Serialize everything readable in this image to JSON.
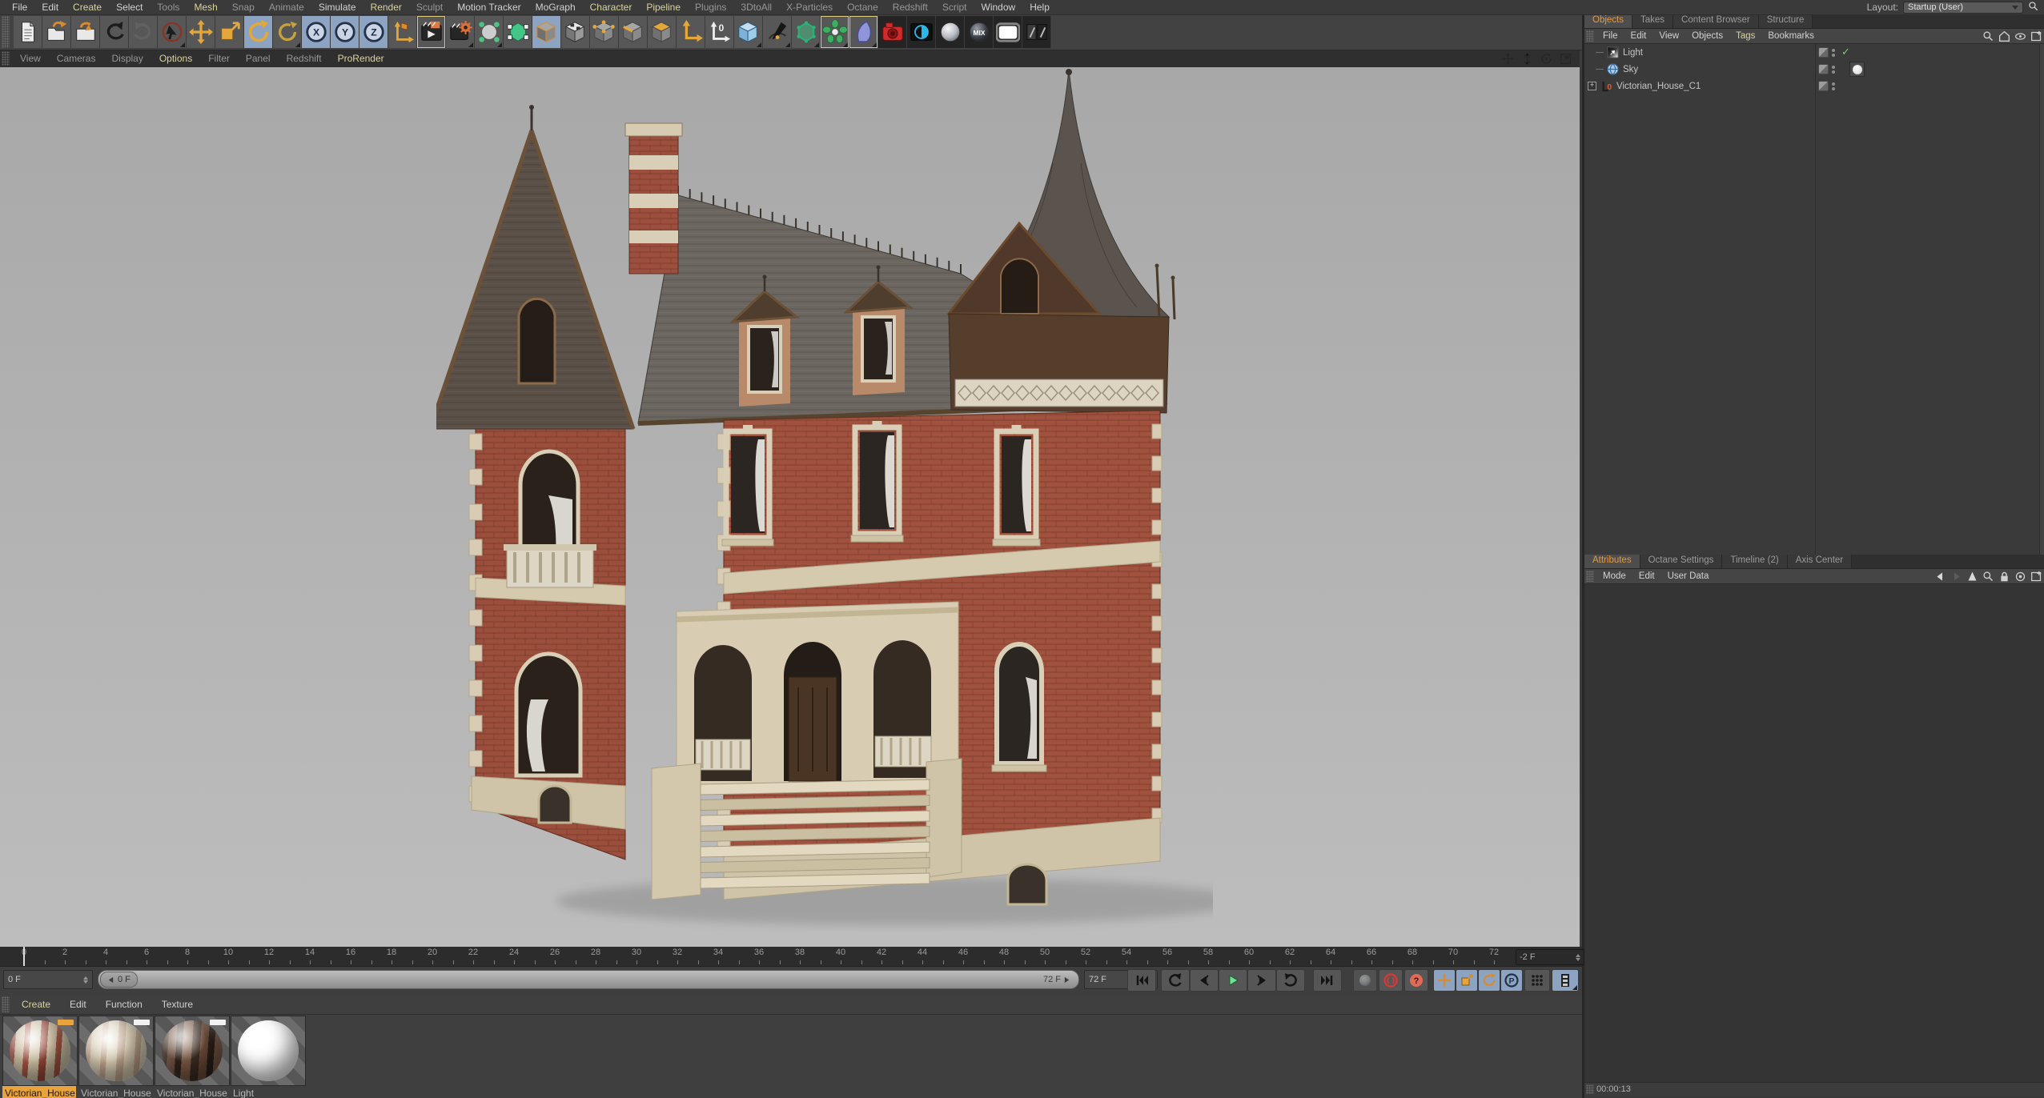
{
  "colors": {
    "accent_orange": "#e09a47",
    "accent_yellow": "#d9d49c",
    "blue_highlight": "#8ca4c2",
    "selected_material": "#e8a33d",
    "play_green": "#6fe08d",
    "record_red": "#d23a3a"
  },
  "menu_bar": {
    "items": [
      {
        "label": "File",
        "tone": "normal"
      },
      {
        "label": "Edit",
        "tone": "normal"
      },
      {
        "label": "Create",
        "tone": "accent"
      },
      {
        "label": "Select",
        "tone": "normal"
      },
      {
        "label": "Tools",
        "tone": "dim"
      },
      {
        "label": "Mesh",
        "tone": "accent"
      },
      {
        "label": "Snap",
        "tone": "dim"
      },
      {
        "label": "Animate",
        "tone": "dim"
      },
      {
        "label": "Simulate",
        "tone": "normal"
      },
      {
        "label": "Render",
        "tone": "accent"
      },
      {
        "label": "Sculpt",
        "tone": "dim"
      },
      {
        "label": "Motion Tracker",
        "tone": "normal"
      },
      {
        "label": "MoGraph",
        "tone": "normal"
      },
      {
        "label": "Character",
        "tone": "accent"
      },
      {
        "label": "Pipeline",
        "tone": "accent"
      },
      {
        "label": "Plugins",
        "tone": "dim"
      },
      {
        "label": "3DtoAll",
        "tone": "dim"
      },
      {
        "label": "X-Particles",
        "tone": "dim"
      },
      {
        "label": "Octane",
        "tone": "dim"
      },
      {
        "label": "Redshift",
        "tone": "dim"
      },
      {
        "label": "Script",
        "tone": "dim"
      },
      {
        "label": "Window",
        "tone": "normal"
      },
      {
        "label": "Help",
        "tone": "normal"
      }
    ],
    "layout_label": "Layout:",
    "layout_value": "Startup (User)"
  },
  "toolbar": {
    "icons": [
      {
        "name": "new-file-icon"
      },
      {
        "name": "open-file-icon"
      },
      {
        "name": "save-file-icon"
      },
      {
        "name": "undo-icon"
      },
      {
        "name": "redo-icon",
        "disabled": true
      },
      {
        "name": "select-tool-icon",
        "corner": true
      },
      {
        "name": "move-tool-icon"
      },
      {
        "name": "scale-tool-icon"
      },
      {
        "name": "rotate-tool-icon",
        "bg": "blue"
      },
      {
        "name": "last-tool-icon",
        "corner": true
      },
      {
        "name": "lock-x-icon",
        "bg": "blue",
        "letter": "X"
      },
      {
        "name": "lock-y-icon",
        "bg": "blue",
        "letter": "Y"
      },
      {
        "name": "lock-z-icon",
        "bg": "blue",
        "letter": "Z"
      },
      {
        "name": "coord-system-icon"
      },
      {
        "name": "render-view-icon",
        "frame": "yellow"
      },
      {
        "name": "render-settings-icon",
        "corner": true
      },
      {
        "name": "subdivision-surface-icon",
        "corner": true
      },
      {
        "name": "make-editable-icon"
      },
      {
        "name": "model-mode-icon",
        "bg": "blue"
      },
      {
        "name": "texture-mode-icon"
      },
      {
        "name": "point-mode-icon"
      },
      {
        "name": "edge-mode-icon"
      },
      {
        "name": "polygon-mode-icon"
      },
      {
        "name": "axis-mode-icon"
      },
      {
        "name": "workplane-mode-icon"
      },
      {
        "name": "primitive-cube-icon",
        "corner": true
      },
      {
        "name": "spline-pen-icon",
        "corner": true
      },
      {
        "name": "deformer-icon",
        "corner": true
      },
      {
        "name": "mograph-cloner-icon",
        "frame": "yellow",
        "corner": true
      },
      {
        "name": "field-icon",
        "frame": "yellow",
        "corner": true
      },
      {
        "name": "octane-camera-icon",
        "bg": "dark"
      },
      {
        "name": "octane-live-viewer-icon",
        "bg": "dark"
      },
      {
        "name": "material-ball-icon",
        "bg": "dark"
      },
      {
        "name": "mix-material-icon",
        "bg": "dark",
        "label": "MIX"
      },
      {
        "name": "light-material-icon",
        "bg": "dark"
      },
      {
        "name": "texture-pair-icon",
        "bg": "dark"
      }
    ]
  },
  "viewport": {
    "menu": [
      {
        "label": "View",
        "tone": "dim"
      },
      {
        "label": "Cameras",
        "tone": "dim"
      },
      {
        "label": "Display",
        "tone": "dim"
      },
      {
        "label": "Options",
        "tone": "accent"
      },
      {
        "label": "Filter",
        "tone": "dim"
      },
      {
        "label": "Panel",
        "tone": "dim"
      },
      {
        "label": "Redshift",
        "tone": "dim"
      },
      {
        "label": "ProRender",
        "tone": "accent"
      }
    ],
    "nav_icons": [
      {
        "name": "pan-view-icon"
      },
      {
        "name": "zoom-view-icon"
      },
      {
        "name": "orbit-view-icon"
      },
      {
        "name": "maximize-view-icon"
      }
    ]
  },
  "objects_panel": {
    "tabs": [
      {
        "label": "Objects",
        "active": true
      },
      {
        "label": "Takes"
      },
      {
        "label": "Content Browser"
      },
      {
        "label": "Structure"
      }
    ],
    "menu": [
      {
        "label": "File",
        "tone": "normal"
      },
      {
        "label": "Edit",
        "tone": "normal"
      },
      {
        "label": "View",
        "tone": "normal"
      },
      {
        "label": "Objects",
        "tone": "normal"
      },
      {
        "label": "Tags",
        "tone": "accent"
      },
      {
        "label": "Bookmarks",
        "tone": "normal"
      }
    ],
    "icons": [
      {
        "name": "search-icon"
      },
      {
        "name": "path-home-icon"
      },
      {
        "name": "eye-filter-icon"
      },
      {
        "name": "add-panel-icon"
      }
    ],
    "tree": [
      {
        "name": "Light",
        "icon": "light-object-icon",
        "check": true
      },
      {
        "name": "Sky",
        "icon": "sky-object-icon",
        "material_tag": "light-material-tag"
      },
      {
        "name": "Victorian_House_C1",
        "icon": "xref-object-icon",
        "expandable": true
      }
    ]
  },
  "attributes_panel": {
    "tabs": [
      {
        "label": "Attributes",
        "active": true
      },
      {
        "label": "Octane Settings"
      },
      {
        "label": "Timeline (2)"
      },
      {
        "label": "Axis Center"
      }
    ],
    "menu": [
      {
        "label": "Mode",
        "tone": "normal"
      },
      {
        "label": "Edit",
        "tone": "normal"
      },
      {
        "label": "User Data",
        "tone": "normal"
      }
    ],
    "icons": [
      {
        "name": "history-back-icon"
      },
      {
        "name": "history-forward-icon",
        "disabled": true
      },
      {
        "name": "up-level-icon"
      },
      {
        "name": "search-icon"
      },
      {
        "name": "lock-icon"
      },
      {
        "name": "target-icon"
      },
      {
        "name": "add-panel-icon"
      }
    ]
  },
  "status_bar": {
    "time": "00:00:13"
  },
  "timeline": {
    "ruler": {
      "start": 0,
      "end": 72,
      "label_step": 2,
      "marker_frame": 0,
      "offset_field": "-2 F"
    },
    "transport": {
      "current_frame": "0 F",
      "slider_handle": "0 F",
      "slider_end": "72 F",
      "end_frame": "72 F",
      "buttons": [
        {
          "name": "goto-start-button"
        },
        {
          "name": "prev-key-button"
        },
        {
          "name": "prev-frame-button"
        },
        {
          "name": "play-button"
        },
        {
          "name": "next-frame-button"
        },
        {
          "name": "next-key-button"
        },
        {
          "name": "goto-end-button"
        }
      ],
      "right_icons": [
        {
          "name": "autokey-icon",
          "disabled": true
        },
        {
          "name": "record-keyframe-icon"
        },
        {
          "name": "keyframe-help-icon"
        },
        {
          "name": "key-position-icon",
          "bg": "blue"
        },
        {
          "name": "key-scale-icon",
          "bg": "blue"
        },
        {
          "name": "key-rotation-icon",
          "bg": "blue"
        },
        {
          "name": "key-parameter-icon",
          "bg": "blue"
        },
        {
          "name": "key-pla-icon"
        },
        {
          "name": "timeline-mode-icon",
          "bg": "blue",
          "corner": true
        }
      ]
    }
  },
  "materials": {
    "menu": [
      {
        "label": "Create",
        "tone": "accent"
      },
      {
        "label": "Edit",
        "tone": "normal"
      },
      {
        "label": "Function",
        "tone": "normal"
      },
      {
        "label": "Texture",
        "tone": "normal"
      }
    ],
    "items": [
      {
        "label": "Victorian_House_",
        "selected": true,
        "badge": "orange",
        "variant": "v-brick-light"
      },
      {
        "label": "Victorian_House_",
        "badge": "white",
        "variant": "v-brick-pale"
      },
      {
        "label": "Victorian_House_",
        "badge": "white",
        "variant": "v-brick-dark"
      },
      {
        "label": "Light",
        "variant": "v-white"
      }
    ]
  }
}
